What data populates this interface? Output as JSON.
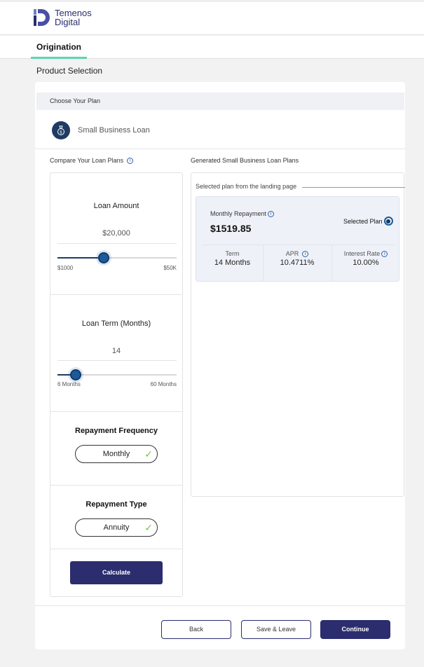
{
  "header": {
    "logo_line1": "Temenos",
    "logo_line2": "Digital"
  },
  "tabs": [
    {
      "label": "Origination"
    }
  ],
  "page_title": "Product Selection",
  "plan": {
    "heading": "Choose Your Plan",
    "product_label": "Small Business Loan"
  },
  "compare": {
    "label": "Compare Your Loan Plans",
    "loan_amount": {
      "title": "Loan Amount",
      "value": "$20,000",
      "min_label": "$1000",
      "max_label": "$50K",
      "position": 0.39
    },
    "loan_term": {
      "title": "Loan Term (Months)",
      "value": "14",
      "min_label": "6 Months",
      "max_label": "60 Months",
      "position": 0.15
    },
    "repayment_frequency": {
      "title": "Repayment Frequency",
      "selected": "Monthly"
    },
    "repayment_type": {
      "title": "Repayment Type",
      "selected": "Annuity"
    },
    "calculate_label": "Calculate"
  },
  "generated": {
    "label": "Generated Small Business Loan Plans",
    "selected_caption": "Selected plan from the landing page",
    "monthly_repayment_label": "Monthly Repayment",
    "monthly_repayment_value": "$1519.85",
    "selected_plan_label": "Selected Plan",
    "term_label": "Term",
    "term_value": "14 Months",
    "apr_label": "APR",
    "apr_value": "10.4711%",
    "interest_label": "Interest Rate",
    "interest_value": "10.00%"
  },
  "footer": {
    "back_label": "Back",
    "save_label": "Save & Leave",
    "continue_label": "Continue"
  },
  "colors": {
    "primary": "#2b2d6e",
    "accent_tab": "#5fd3b4",
    "check": "#7bc142",
    "slider": "#1e5a9a"
  }
}
